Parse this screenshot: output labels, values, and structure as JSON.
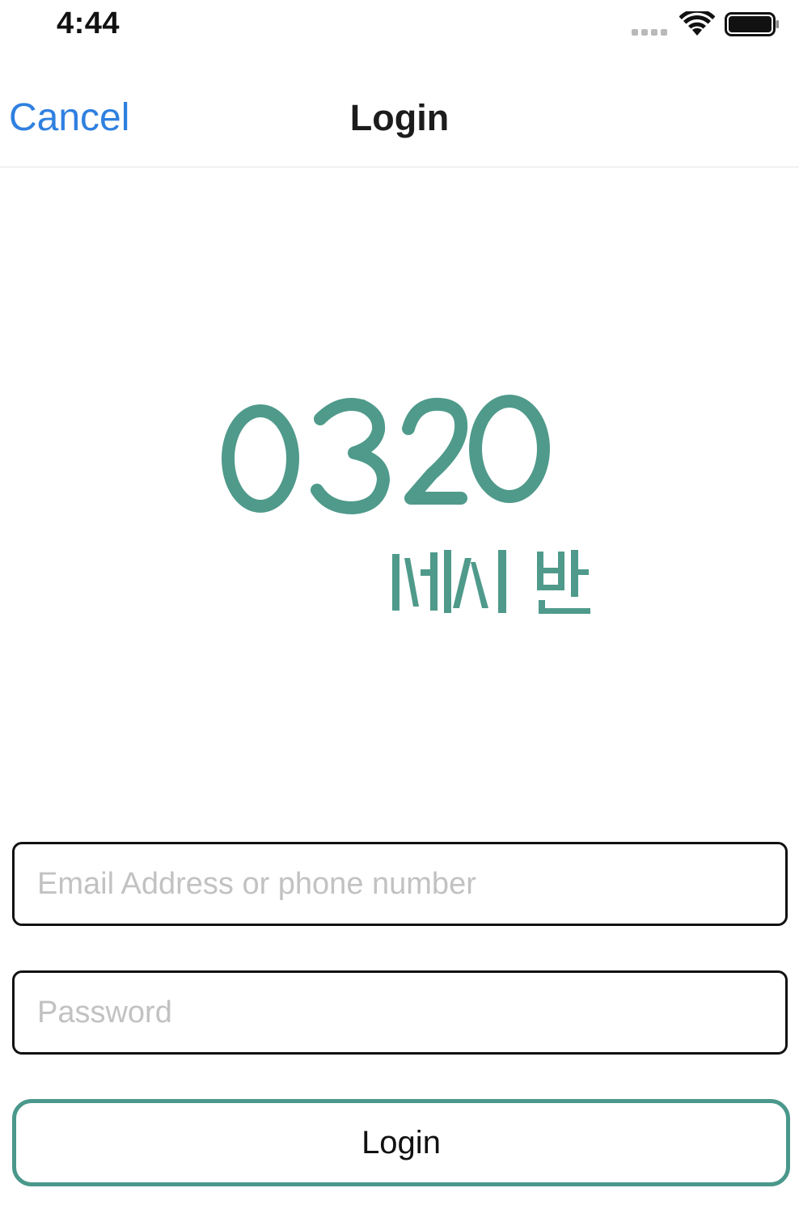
{
  "status_bar": {
    "time": "4:44",
    "wifi_icon": "wifi-icon",
    "battery_icon": "battery-icon"
  },
  "nav": {
    "cancel_label": "Cancel",
    "title": "Login"
  },
  "logo": {
    "icon": "brand-logo",
    "numerals": "0320",
    "subtitle": "세시 반",
    "color": "#4f9a8b"
  },
  "form": {
    "email_placeholder": "Email Address or phone number",
    "email_value": "",
    "password_placeholder": "Password",
    "password_value": "",
    "login_label": "Login",
    "accent_color": "#4a988c"
  }
}
